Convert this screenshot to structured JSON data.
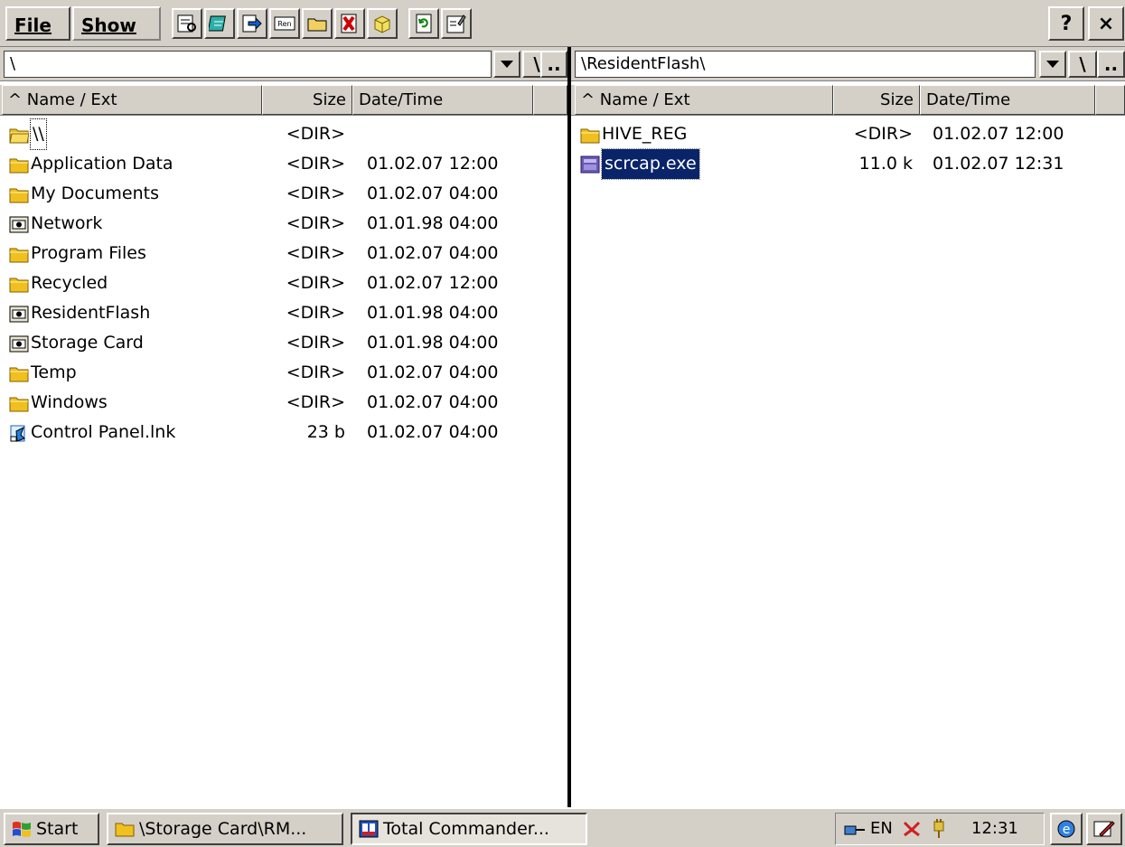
{
  "toolbar": {
    "menus": [
      "File",
      "Show"
    ],
    "buttons": [
      "view-icon",
      "notes-icon",
      "copy-icon",
      "rename-icon",
      "folder-icon",
      "delete-icon",
      "pack-icon",
      "refresh-icon",
      "properties-icon"
    ],
    "help_label": "?",
    "close_label": "×"
  },
  "left_panel": {
    "path": "\\",
    "root_label": "\\",
    "up_label": "..",
    "columns": {
      "name": "^ Name / Ext",
      "size": "Size",
      "date": "Date/Time"
    },
    "files": [
      {
        "icon": "folder-open-icon",
        "name": "\\\\",
        "size": "<DIR>",
        "date": ""
      },
      {
        "icon": "folder-icon",
        "name": "Application Data",
        "size": "<DIR>",
        "date": "01.02.07 12:00"
      },
      {
        "icon": "folder-icon",
        "name": "My Documents",
        "size": "<DIR>",
        "date": "01.02.07 04:00"
      },
      {
        "icon": "drive-folder-icon",
        "name": "Network",
        "size": "<DIR>",
        "date": "01.01.98 04:00"
      },
      {
        "icon": "folder-icon",
        "name": "Program Files",
        "size": "<DIR>",
        "date": "01.02.07 04:00"
      },
      {
        "icon": "folder-icon",
        "name": "Recycled",
        "size": "<DIR>",
        "date": "01.02.07 12:00"
      },
      {
        "icon": "drive-folder-icon",
        "name": "ResidentFlash",
        "size": "<DIR>",
        "date": "01.01.98 04:00"
      },
      {
        "icon": "drive-folder-icon",
        "name": "Storage Card",
        "size": "<DIR>",
        "date": "01.01.98 04:00"
      },
      {
        "icon": "folder-icon",
        "name": "Temp",
        "size": "<DIR>",
        "date": "01.02.07 04:00"
      },
      {
        "icon": "folder-icon",
        "name": "Windows",
        "size": "<DIR>",
        "date": "01.02.07 04:00"
      },
      {
        "icon": "shortcut-icon",
        "name": "Control Panel.lnk",
        "size": "23 b",
        "date": "01.02.07 04:00"
      }
    ]
  },
  "right_panel": {
    "path": "\\ResidentFlash\\",
    "root_label": "\\",
    "up_label": "..",
    "columns": {
      "name": "^ Name / Ext",
      "size": "Size",
      "date": "Date/Time"
    },
    "files": [
      {
        "icon": "folder-icon",
        "name": "HIVE_REG",
        "size": "<DIR>",
        "date": "01.02.07 12:00"
      },
      {
        "icon": "exe-icon",
        "name": "scrcap.exe",
        "size": "11.0 k",
        "date": "01.02.07 12:31"
      }
    ]
  },
  "taskbar": {
    "start_label": "Start",
    "tasks": [
      {
        "label": "\\Storage Card\\RM...",
        "icon": "folder-icon"
      },
      {
        "label": "Total Commander...",
        "icon": "totalcmd-icon"
      }
    ],
    "tray": {
      "lang": "EN",
      "time": "12:31"
    }
  },
  "colors": {
    "chrome": "#d4d0c8",
    "selection": "#0a246a",
    "folder": "#f0c020"
  }
}
